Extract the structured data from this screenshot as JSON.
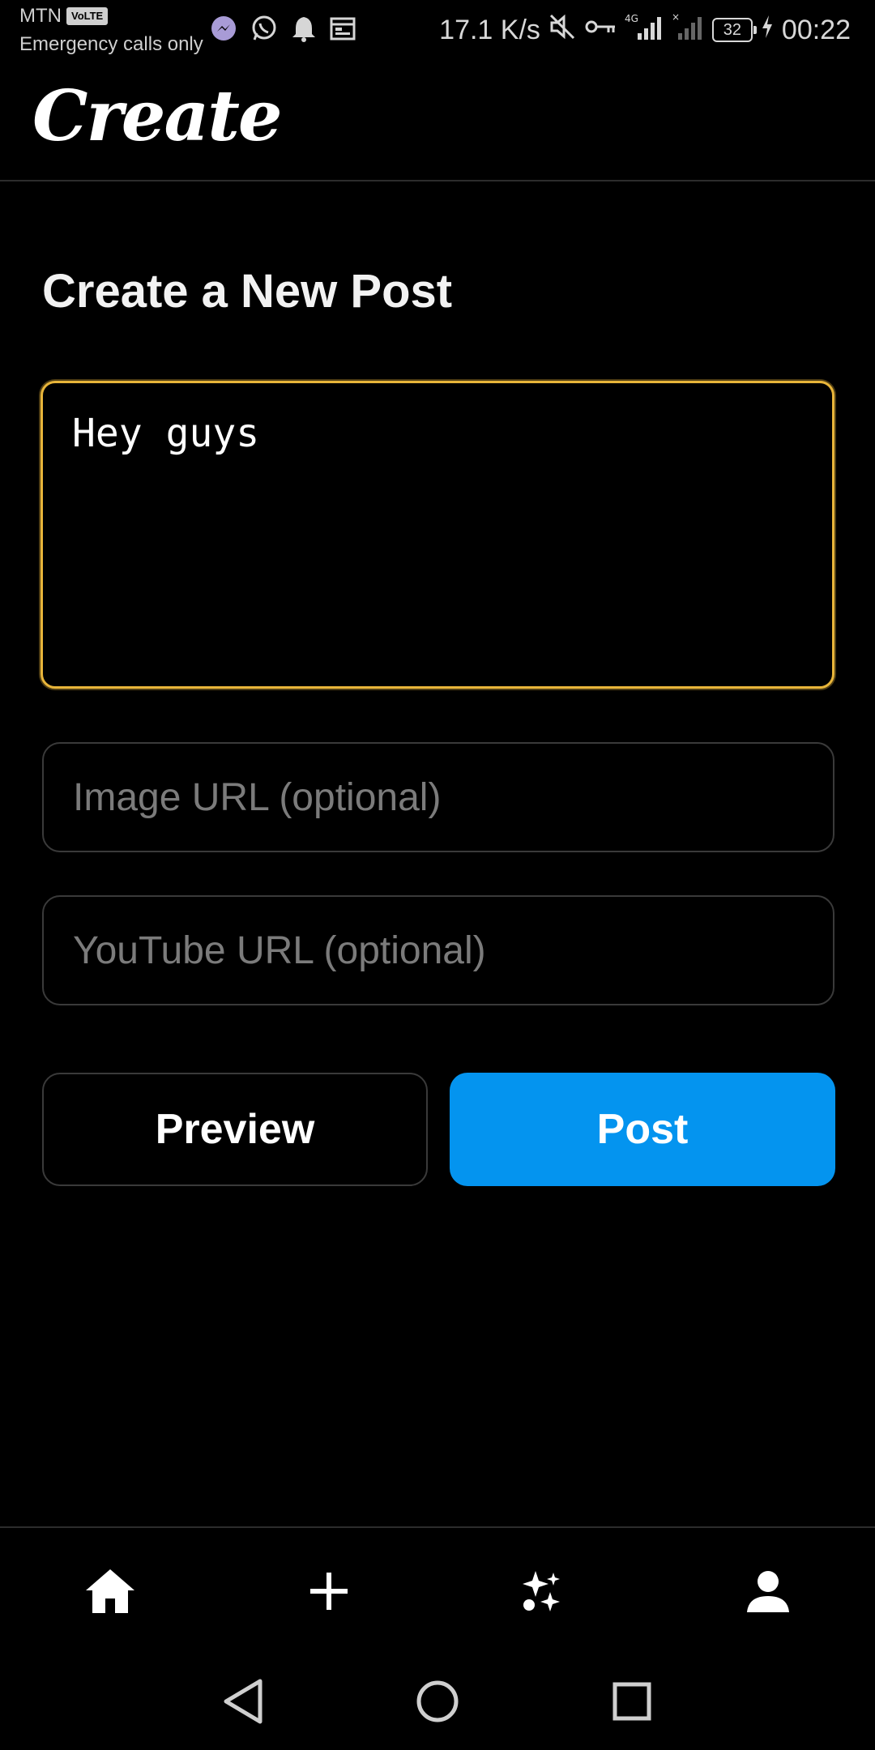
{
  "status_bar": {
    "carrier": "MTN",
    "volte": "VoLTE",
    "emergency_text": "Emergency calls only",
    "net_speed": "17.1 K/s",
    "network_type": "4G",
    "battery_level": "32",
    "time": "00:22",
    "notification_icons": [
      "messenger-icon",
      "whatsapp-icon",
      "bell-icon",
      "calendar-icon"
    ],
    "system_icons": [
      "mute-icon",
      "vpn-key-icon",
      "signal-icon",
      "signal-empty-icon",
      "battery-icon",
      "charging-icon"
    ]
  },
  "header": {
    "logo_text": "Create"
  },
  "form": {
    "title": "Create a New Post",
    "post_text_value": "Hey guys",
    "image_url_placeholder": "Image URL (optional)",
    "youtube_url_placeholder": "YouTube URL (optional)",
    "preview_label": "Preview",
    "post_label": "Post"
  },
  "bottom_nav": {
    "items": [
      {
        "icon": "home-icon"
      },
      {
        "icon": "plus-icon"
      },
      {
        "icon": "sparkles-icon"
      },
      {
        "icon": "profile-icon"
      }
    ]
  },
  "system_nav": {
    "buttons": [
      "back-icon",
      "home-circle-icon",
      "recents-icon"
    ]
  },
  "colors": {
    "background": "#000000",
    "focus_border": "#e8b53a",
    "post_button": "#0494ef",
    "input_border": "#3a3a3a",
    "placeholder": "#7b7b7b"
  }
}
